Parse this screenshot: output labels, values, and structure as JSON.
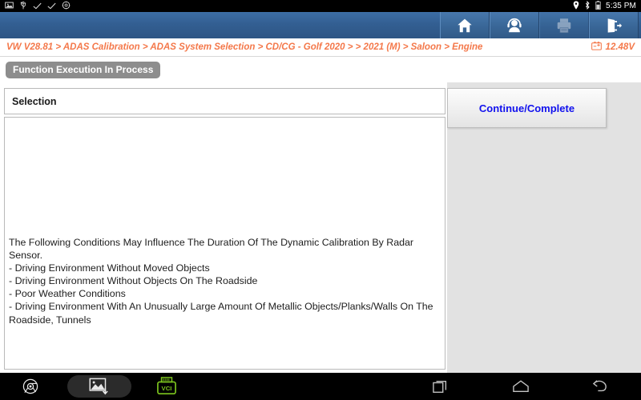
{
  "statusbar": {
    "icons": [
      "screenshot-icon",
      "usb-icon",
      "check-icon",
      "check-icon",
      "settings-gear-icon"
    ],
    "location_icon": "location-pin-icon",
    "bluetooth_icon": "bluetooth-icon",
    "battery_icon": "battery-icon",
    "time": "5:35 PM"
  },
  "toolbar": {
    "home_label": "home-button",
    "support_label": "support-headset-button",
    "print_label": "print-button",
    "exit_label": "exit-button"
  },
  "breadcrumb": {
    "path": "VW V28.81 > ADAS Calibration > ADAS System Selection  > CD/CG - Golf 2020 > > 2021 (M) > Saloon > Engine",
    "voltage": "12.48V"
  },
  "function_tag": {
    "label": "Function Execution In Process"
  },
  "selection_panel": {
    "header": "Selection",
    "body_text": "The Following Conditions May Influence The Duration Of The Dynamic Calibration By Radar Sensor.\n- Driving Environment Without Moved Objects\n- Driving Environment Without Objects On The Roadside\n- Poor Weather Conditions\n- Driving Environment With An Unusually Large Amount Of Metallic Objects/Planks/Walls On The Roadside, Tunnels"
  },
  "actions": {
    "continue_label": "Continue/Complete"
  },
  "dock": {
    "chrome_label": "chrome-browser-icon",
    "screenshot_label": "screenshot-capture-icon",
    "vci_label": "VCI",
    "recents_label": "recent-apps-button",
    "home_label": "android-home-button",
    "back_label": "android-back-button"
  },
  "colors": {
    "toolbar_blue": "#335f92",
    "breadcrumb_orange": "#f4784a",
    "accent_blue": "#1111ee",
    "tag_gray": "#8d8d8d",
    "panel_gray": "#e2e2e2",
    "vci_green": "#7dc61e"
  }
}
